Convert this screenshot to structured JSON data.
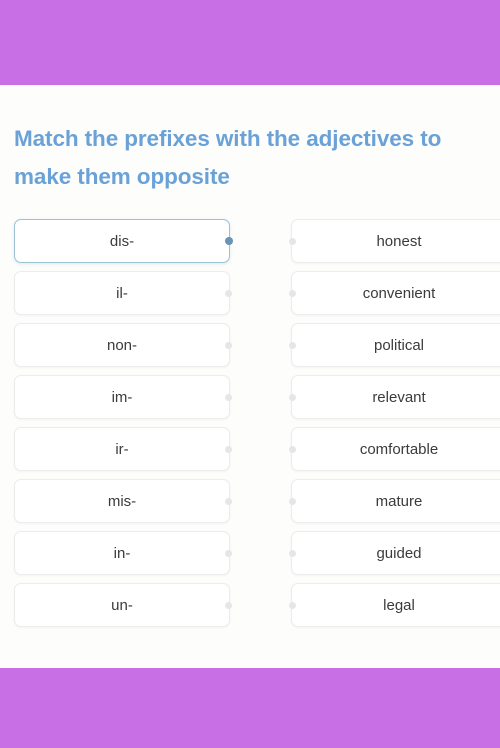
{
  "theme": {
    "band_color": "#c86fe6",
    "title_color": "#6aa2d8",
    "page_background": "#fdfdfb",
    "card_background": "#ffffff",
    "card_border": "#ececec",
    "selected_border": "#9dc2d3",
    "selected_dot": "#6a93b8",
    "card_text": "#3b3b3b"
  },
  "exercise": {
    "title": "Match the prefixes with the adjectives to make them opposite",
    "prefixes": [
      {
        "label": "dis-",
        "selected": true
      },
      {
        "label": "il-",
        "selected": false
      },
      {
        "label": "non-",
        "selected": false
      },
      {
        "label": "im-",
        "selected": false
      },
      {
        "label": "ir-",
        "selected": false
      },
      {
        "label": "mis-",
        "selected": false
      },
      {
        "label": "in-",
        "selected": false
      },
      {
        "label": "un-",
        "selected": false
      }
    ],
    "adjectives": [
      {
        "label": "honest",
        "selected": false
      },
      {
        "label": "convenient",
        "selected": false
      },
      {
        "label": "political",
        "selected": false
      },
      {
        "label": "relevant",
        "selected": false
      },
      {
        "label": "comfortable",
        "selected": false
      },
      {
        "label": "mature",
        "selected": false
      },
      {
        "label": "guided",
        "selected": false
      },
      {
        "label": "legal",
        "selected": false
      }
    ]
  }
}
